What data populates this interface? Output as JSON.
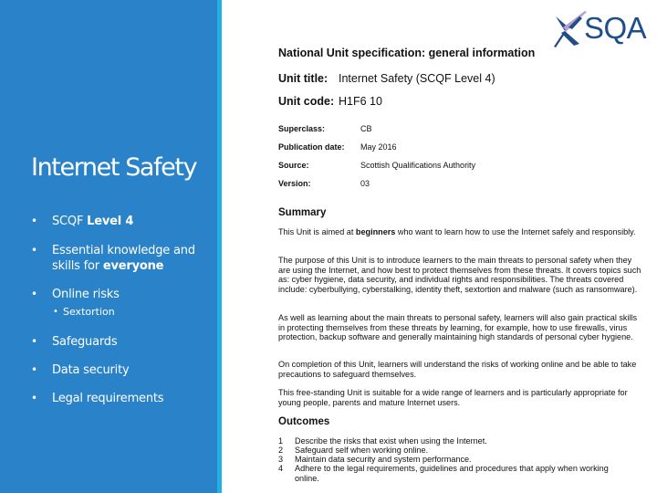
{
  "slide": {
    "title": "Internet Safety",
    "bullets": [
      {
        "plain": "SCQF ",
        "bold": "Level 4"
      },
      {
        "plain": "Essential knowledge and skills for ",
        "bold": "everyone"
      },
      {
        "plain": "Online risks",
        "bold": ""
      },
      {
        "plain": "Safeguards",
        "bold": ""
      },
      {
        "plain": "Data security",
        "bold": ""
      },
      {
        "plain": "Legal requirements",
        "bold": ""
      }
    ],
    "sub_bullets": [
      "Sextortion"
    ],
    "bullet_glyph": "•",
    "colors": {
      "panel": "#2a83c8",
      "stripe": "#25aee6",
      "text": "#ffffff"
    }
  },
  "logo": {
    "text": "SQA",
    "icon": "sqa-cross-icon",
    "colors": {
      "text": "#1f4e89",
      "swoosh": "#b99fcb"
    }
  },
  "document": {
    "heading": "National Unit specification: general information",
    "unit_title_label": "Unit title:",
    "unit_title_value": "Internet Safety (SCQF Level 4)",
    "unit_code_label": "Unit code:",
    "unit_code_value": "H1F6 10",
    "meta": [
      {
        "label": "Superclass:",
        "value": "CB"
      },
      {
        "label": "Publication date:",
        "value": "May 2016"
      },
      {
        "label": "Source:",
        "value": "Scottish Qualifications Authority"
      },
      {
        "label": "Version:",
        "value": "03"
      }
    ],
    "summary_heading": "Summary",
    "summary_intro_pre": "This Unit is aimed at ",
    "summary_intro_bold": "beginners",
    "summary_intro_post": " who want to learn how to use the Internet safely and responsibly.",
    "paragraphs": [
      "The purpose of this Unit is to introduce learners to the main threats to personal safety when they are using the Internet, and how best to protect themselves from these threats. It covers topics such as: cyber hygiene, data security, and individual rights and responsibilities. The threats covered include: cyberbullying, cyberstalking, identity theft, sextortion and malware (such as ransomware).",
      "As well as learning about the main threats to personal safety, learners will also gain practical skills in protecting themselves from these threats by learning, for example, how to use firewalls, virus protection, backup software and generally maintaining high standards of personal cyber hygiene.",
      "On completion of this Unit, learners will understand the risks of working online and be able to take precautions to safeguard themselves.",
      "This free-standing Unit is suitable for a wide range of learners and is particularly appropriate for young people, parents and mature Internet users."
    ],
    "outcomes_heading": "Outcomes",
    "outcomes": [
      {
        "num": "1",
        "text": "Describe the risks that exist when using the Internet."
      },
      {
        "num": "2",
        "text": "Safeguard self when working online."
      },
      {
        "num": "3",
        "text": "Maintain data security and system performance."
      },
      {
        "num": "4",
        "text": "Adhere to the legal requirements, guidelines and procedures that apply when working online."
      }
    ]
  }
}
